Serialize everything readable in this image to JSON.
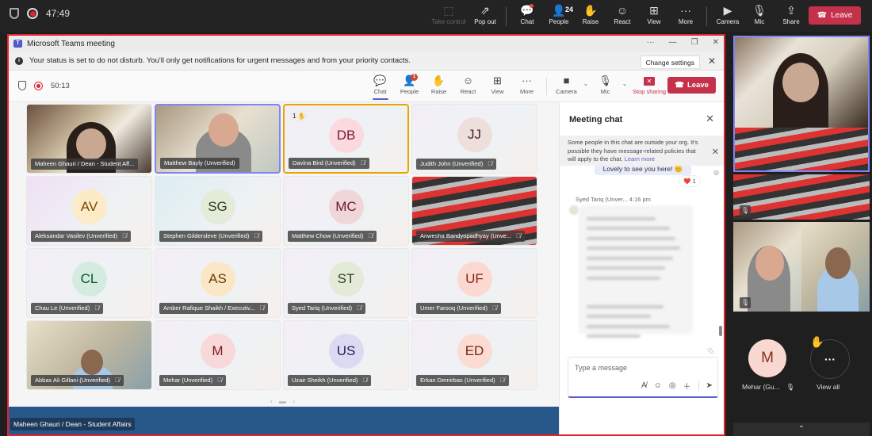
{
  "outer_bar": {
    "timer": "47:49",
    "tools": [
      {
        "label": "Take control",
        "icon": "take-control-icon",
        "glyph": "⬚",
        "disabled": true
      },
      {
        "label": "Pop out",
        "icon": "pop-out-icon",
        "glyph": "⇗",
        "disabled": false
      },
      {
        "label": "Chat",
        "icon": "chat-icon",
        "glyph": "💬",
        "disabled": false,
        "dot": true
      },
      {
        "label": "People",
        "icon": "people-icon",
        "glyph": "👤",
        "count": "24",
        "disabled": false
      },
      {
        "label": "Raise",
        "icon": "raise-hand-icon",
        "glyph": "✋",
        "disabled": false
      },
      {
        "label": "React",
        "icon": "react-icon",
        "glyph": "☺",
        "disabled": false
      },
      {
        "label": "View",
        "icon": "view-icon",
        "glyph": "⊞",
        "disabled": false
      },
      {
        "label": "More",
        "icon": "more-icon",
        "glyph": "···",
        "disabled": false
      },
      {
        "label": "Camera",
        "icon": "camera-off-icon",
        "glyph": "▶",
        "disabled": false
      },
      {
        "label": "Mic",
        "icon": "mic-off-icon",
        "glyph": "🎙",
        "disabled": false
      },
      {
        "label": "Share",
        "icon": "share-icon",
        "glyph": "⇪",
        "disabled": false
      }
    ],
    "leave_label": "Leave"
  },
  "window": {
    "title": "Microsoft Teams meeting",
    "controls": [
      "···",
      "—",
      "❐",
      "✕"
    ],
    "banner": {
      "text": "Your status is set to do not disturb. You'll only get notifications for urgent messages and from your priority contacts.",
      "button": "Change settings"
    },
    "timer": "50:13",
    "tools": [
      {
        "label": "Chat",
        "glyph": "💬",
        "active": true
      },
      {
        "label": "People",
        "glyph": "👤",
        "badge": "1"
      },
      {
        "label": "Raise",
        "glyph": "✋"
      },
      {
        "label": "React",
        "glyph": "☺"
      },
      {
        "label": "View",
        "glyph": "⊞"
      },
      {
        "label": "More",
        "glyph": "···"
      }
    ],
    "camera_label": "Camera",
    "mic_label": "Mic",
    "stop_sharing_label": "Stop sharing",
    "leave_label": "Leave"
  },
  "participants": [
    {
      "name": "Maheen Ghauri / Dean - Student Aff...",
      "video": "home",
      "speaker": false
    },
    {
      "name": "Matthew Bayly (Unverified)",
      "video": "bright",
      "speaker": true
    },
    {
      "name": "Davina Bird (Unverified)",
      "initials": "DB",
      "bg": "#fbd9df",
      "fg": "#7a1a2e",
      "hand": "1",
      "muted": true
    },
    {
      "name": "Judith John (Unverified)",
      "initials": "JJ",
      "bg": "#eedfdc",
      "fg": "#4a2418",
      "muted": true
    },
    {
      "name": "Aleksandar Vasilev (Unverified)",
      "initials": "AV",
      "bg": "#fbebc6",
      "fg": "#7a4a00",
      "muted": true,
      "tint": "#f0e0f4"
    },
    {
      "name": "Stephen Gildersleve (Unverified)",
      "initials": "SG",
      "bg": "#e4ebd9",
      "fg": "#2e4020",
      "muted": true,
      "tint": "#dcedf2"
    },
    {
      "name": "Matthew Chow (Unverified)",
      "initials": "MC",
      "bg": "#f1d6d9",
      "fg": "#6b1a2a",
      "muted": true
    },
    {
      "name": "Anwesha Bandyopadhyay (Unve...",
      "video": "room",
      "muted": true
    },
    {
      "name": "Chau Le (Unverified)",
      "initials": "CL",
      "bg": "#d4ecdf",
      "fg": "#0b5234",
      "muted": true
    },
    {
      "name": "Amber Rafique Shaikh / Executiv...",
      "initials": "AS",
      "bg": "#fbe7c6",
      "fg": "#6b3e00",
      "muted": true
    },
    {
      "name": "Syed Tariq (Unverified)",
      "initials": "ST",
      "bg": "#e3ead8",
      "fg": "#2f4222",
      "muted": true
    },
    {
      "name": "Umer Farooq (Unverified)",
      "initials": "UF",
      "bg": "#fbd9d0",
      "fg": "#8a2412",
      "muted": true
    },
    {
      "name": "Abbas Ali Gillani (Unverified)",
      "video": "office",
      "muted": true
    },
    {
      "name": "Mehar (Unverified)",
      "initials": "M",
      "bg": "#f8d8d8",
      "fg": "#7a1a22",
      "muted": true
    },
    {
      "name": "Uzair Sheikh (Unverified)",
      "initials": "US",
      "bg": "#dcdaf2",
      "fg": "#1e1e5c",
      "muted": true
    },
    {
      "name": "Erkan Demirbas (Unverified)",
      "initials": "ED",
      "bg": "#fbdcd2",
      "fg": "#7a2412",
      "muted": true
    }
  ],
  "presenter_label": "Maheen Ghauri / Dean - Student Affairs",
  "chat": {
    "title": "Meeting chat",
    "notice": "Some people in this chat are outside your org. It's possible they have message-related policies that will apply to the chat.",
    "learn_more": "Learn more",
    "my_message": "Lovely to see you here! 😊",
    "reaction": "❤️",
    "reaction_count": "1",
    "sender_meta": "Syed Tariq (Unver...   4:16 pm",
    "compose_placeholder": "Type a message"
  },
  "right_panel": {
    "mehar_label": "Mehar (Gu...",
    "mehar_initials": "M",
    "view_all": "View all"
  }
}
